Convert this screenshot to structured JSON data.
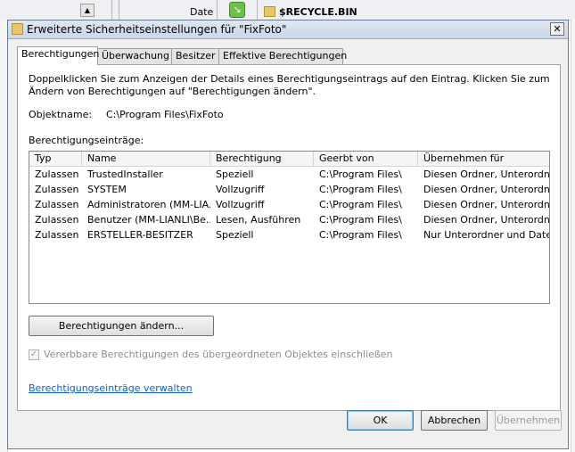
{
  "background": {
    "column_date": "Date",
    "folder_name": "$RECYCLE.BIN",
    "scroll_up_glyph": "▲",
    "green_icon_glyph": "↘"
  },
  "dialog": {
    "title": "Erweiterte Sicherheitseinstellungen für \"FixFoto\"",
    "close_glyph": "✕",
    "tabs": [
      {
        "label": "Berechtigungen",
        "active": true
      },
      {
        "label": "Überwachung",
        "active": false
      },
      {
        "label": "Besitzer",
        "active": false
      },
      {
        "label": "Effektive Berechtigungen",
        "active": false
      }
    ],
    "description": "Doppelklicken Sie zum Anzeigen der Details eines Berechtigungseintrags auf den Eintrag. Klicken Sie zum Ändern von Berechtigungen auf \"Berechtigungen ändern\".",
    "object_name_label": "Objektname:",
    "object_name_value": "C:\\Program Files\\FixFoto",
    "entries_label": "Berechtigungseinträge:",
    "table": {
      "columns": [
        "Typ",
        "Name",
        "Berechtigung",
        "Geerbt von",
        "Übernehmen für"
      ],
      "rows": [
        [
          "Zulassen",
          "TrustedInstaller",
          "Speziell",
          "C:\\Program Files\\",
          "Diesen Ordner, Unterordner"
        ],
        [
          "Zulassen",
          "SYSTEM",
          "Vollzugriff",
          "C:\\Program Files\\",
          "Diesen Ordner, Unterordn..."
        ],
        [
          "Zulassen",
          "Administratoren (MM-LIA...",
          "Vollzugriff",
          "C:\\Program Files\\",
          "Diesen Ordner, Unterordn..."
        ],
        [
          "Zulassen",
          "Benutzer (MM-LIANLI\\Be...",
          "Lesen, Ausführen",
          "C:\\Program Files\\",
          "Diesen Ordner, Unterordn..."
        ],
        [
          "Zulassen",
          "ERSTELLER-BESITZER",
          "Speziell",
          "C:\\Program Files\\",
          "Nur Unterordner und Date..."
        ]
      ]
    },
    "change_permissions_button": "Berechtigungen ändern...",
    "inherit_checkbox_label": "Vererbbare Berechtigungen des übergeordneten Objektes einschließen",
    "inherit_checkbox_checked": true,
    "inherit_check_glyph": "✓",
    "manage_link": "Berechtigungseinträge verwalten",
    "buttons": {
      "ok": "OK",
      "cancel": "Abbrechen",
      "apply": "Übernehmen"
    }
  }
}
